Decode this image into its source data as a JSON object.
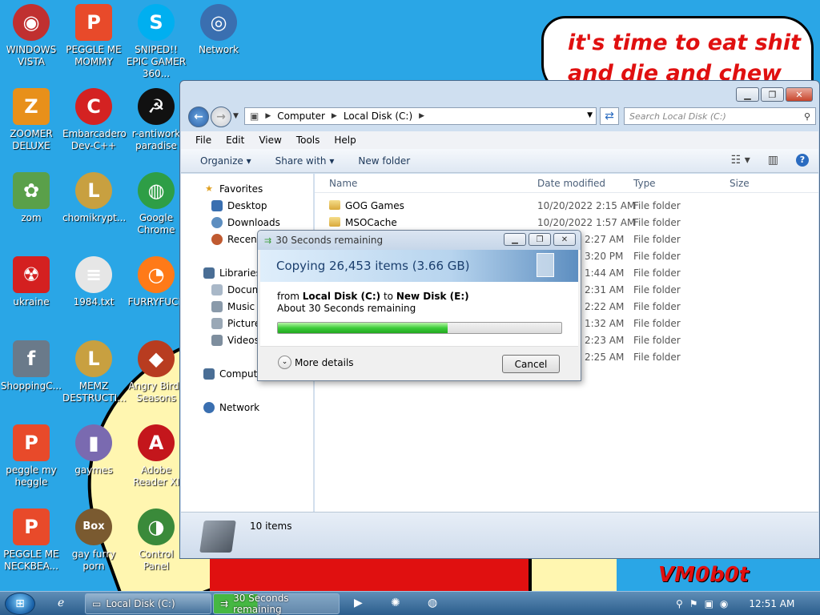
{
  "wallpaper": {
    "speech_text": "it's time to eat shit and die and chew",
    "watermark": "VM0b0t"
  },
  "desktop_icons": [
    {
      "label": "WINDOWS VISTA",
      "glyph": "◉",
      "color": "#c03030"
    },
    {
      "label": "PEGGLE ME MOMMY",
      "glyph": "P",
      "color": "#e84a2a"
    },
    {
      "label": "SNIPED!! EPIC GAMER 360...",
      "glyph": "S",
      "color": "#00aff0"
    },
    {
      "label": "Network",
      "glyph": "◎",
      "color": "#3a6fb0"
    },
    {
      "label": "ZOOMER DELUXE",
      "glyph": "Z",
      "color": "#e8901a"
    },
    {
      "label": "Embarcadero Dev-C++",
      "glyph": "C",
      "color": "#d42222"
    },
    {
      "label": "r-antiwork paradise",
      "glyph": "☭",
      "color": "#111111"
    },
    {
      "label": "zom",
      "glyph": "✿",
      "color": "#5aa04a"
    },
    {
      "label": "chomikrypt...",
      "glyph": "L",
      "color": "#c8a040"
    },
    {
      "label": "Google Chrome",
      "glyph": "◍",
      "color": "#2e9e46"
    },
    {
      "label": "ukraine",
      "glyph": "☢",
      "color": "#d42020"
    },
    {
      "label": "1984.txt",
      "glyph": "≡",
      "color": "#e6e6e6"
    },
    {
      "label": "FURRYFUCK",
      "glyph": "◔",
      "color": "#ff7a18"
    },
    {
      "label": "ShoppingC...",
      "glyph": "f",
      "color": "#6a7a8a"
    },
    {
      "label": "MEMZ DESTRUCTI...",
      "glyph": "L",
      "color": "#c8a040"
    },
    {
      "label": "Angry Birds Seasons",
      "glyph": "◆",
      "color": "#b83c20"
    },
    {
      "label": "peggle my heggle",
      "glyph": "P",
      "color": "#e84a2a"
    },
    {
      "label": "gaymes",
      "glyph": "▮",
      "color": "#7a6ab0"
    },
    {
      "label": "Adobe Reader XI",
      "glyph": "A",
      "color": "#c4161c"
    },
    {
      "label": "PEGGLE ME NECKBEA...",
      "glyph": "P",
      "color": "#e84a2a"
    },
    {
      "label": "gay furry porn",
      "glyph": "Box",
      "color": "#7a5a30"
    },
    {
      "label": "Control Panel",
      "glyph": "◑",
      "color": "#3a8a3a"
    }
  ],
  "explorer": {
    "breadcrumb": [
      "Computer",
      "Local Disk (C:)"
    ],
    "search_placeholder": "Search Local Disk (C:)",
    "menu": [
      "File",
      "Edit",
      "View",
      "Tools",
      "Help"
    ],
    "commands": {
      "organize": "Organize",
      "share_with": "Share with",
      "new_folder": "New folder"
    },
    "nav": {
      "favorites": "Favorites",
      "desktop": "Desktop",
      "downloads": "Downloads",
      "recent": "Recent",
      "libraries": "Libraries",
      "documents": "Docum",
      "music": "Music",
      "pictures": "Picture",
      "videos": "Videos",
      "computer": "Compute",
      "network": "Network"
    },
    "columns": {
      "name": "Name",
      "date": "Date modified",
      "type": "Type",
      "size": "Size"
    },
    "rows": [
      {
        "name": "GOG Games",
        "date": "10/20/2022 2:15 AM",
        "type": "File folder"
      },
      {
        "name": "MSOCache",
        "date": "10/20/2022 1:57 AM",
        "type": "File folder"
      },
      {
        "name": "",
        "date": "2:27 AM",
        "type": "File folder"
      },
      {
        "name": "",
        "date": "3:20 PM",
        "type": "File folder"
      },
      {
        "name": "",
        "date": "1:44 AM",
        "type": "File folder"
      },
      {
        "name": "",
        "date": "2:31 AM",
        "type": "File folder"
      },
      {
        "name": "",
        "date": "2:22 AM",
        "type": "File folder"
      },
      {
        "name": "",
        "date": "1:32 AM",
        "type": "File folder"
      },
      {
        "name": "",
        "date": "2:23 AM",
        "type": "File folder"
      },
      {
        "name": "",
        "date": "2:25 AM",
        "type": "File folder"
      }
    ],
    "items_count": "10 items"
  },
  "copy_dialog": {
    "title": "30 Seconds remaining",
    "heading": "Copying 26,453 items (3.66 GB)",
    "from_word": "from",
    "source": "Local Disk (C:)",
    "to_word": "to",
    "destination": "New Disk (E:)",
    "remaining": "About 30 Seconds remaining",
    "progress_fraction": 0.6,
    "more_details": "More details",
    "cancel": "Cancel"
  },
  "taskbar": {
    "explorer_task": "Local Disk (C:)",
    "copy_task": "30 Seconds remaining",
    "clock": "12:51 AM"
  }
}
